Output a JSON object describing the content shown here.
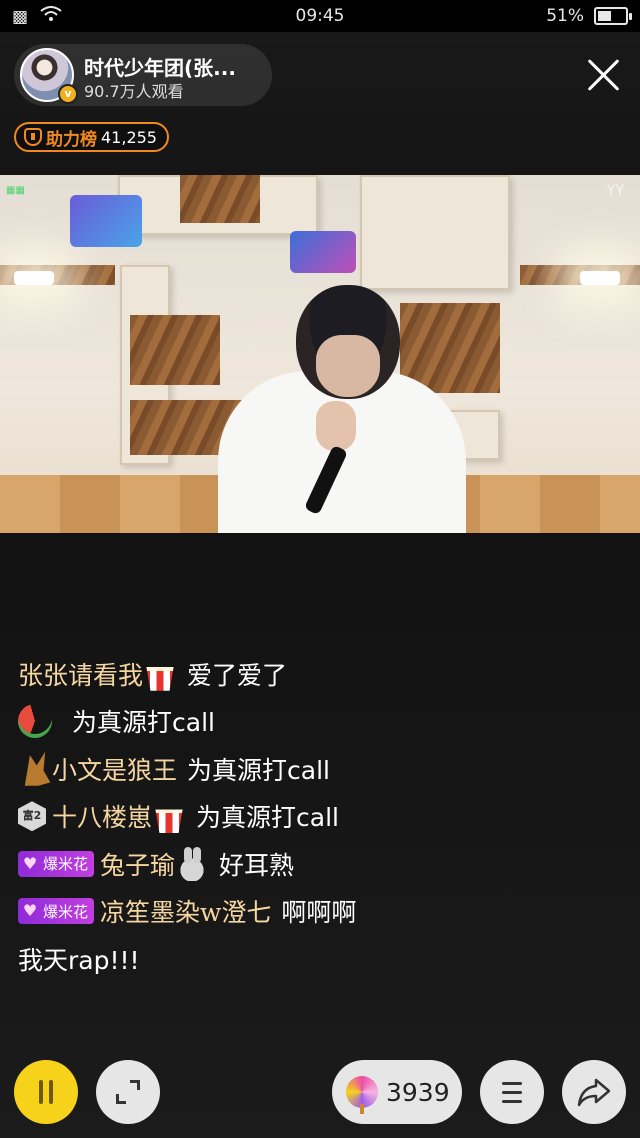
{
  "status_bar": {
    "time": "09:45",
    "battery_percent": "51%",
    "battery_level": 0.51
  },
  "host": {
    "name": "时代少年团(张...",
    "viewers": "90.7万人观看",
    "verified_badge": "v"
  },
  "support_rank": {
    "label": "助力榜",
    "value": "41,255"
  },
  "video": {
    "watermark": "YY"
  },
  "chat": [
    {
      "user": "张张请看我",
      "badge": "popcorn-emoji",
      "message": "爱了爱了"
    },
    {
      "user": "",
      "badge": "watermelon-emoji",
      "message": "为真源打call"
    },
    {
      "user": "小文是狼王",
      "badge": "fox-emoji",
      "message": "为真源打call"
    },
    {
      "user": "十八楼崽",
      "rank_badge": "富2",
      "badge": "popcorn-emoji",
      "message": "为真源打call"
    },
    {
      "user": "兔子瑜",
      "fan_badge": "爆米花",
      "badge": "bunny-emoji",
      "message": "好耳熟"
    },
    {
      "user": "凉笙墨染w澄七",
      "fan_badge": "爆米花",
      "message": "啊啊啊"
    },
    {
      "user": "",
      "message": "我天rap!!!"
    }
  ],
  "bottom_bar": {
    "gift_count": "3939"
  },
  "colors": {
    "accent_yellow": "#f7d21b",
    "rank_orange": "#f08a1e",
    "username_gold": "#f5d6a0",
    "fan_badge_purple": "#a635dc"
  }
}
